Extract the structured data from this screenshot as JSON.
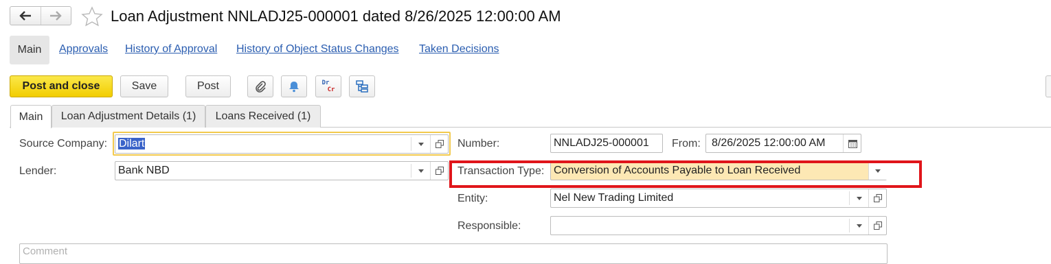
{
  "window": {
    "title": "Loan Adjustment NNLADJ25-000001 dated 8/26/2025 12:00:00 AM"
  },
  "top_nav": {
    "main": "Main",
    "links": [
      "Approvals",
      "History of Approval",
      "History of Object Status Changes",
      "Taken Decisions"
    ]
  },
  "toolbar": {
    "post_and_close": "Post and close",
    "save": "Save",
    "post": "Post",
    "drcr_dr": "Dr",
    "drcr_cr": "Cr"
  },
  "tabs": [
    "Main",
    "Loan Adjustment Details (1)",
    "Loans Received (1)"
  ],
  "form": {
    "source_company": {
      "label": "Source Company:",
      "value": "Dilart"
    },
    "lender": {
      "label": "Lender:",
      "value": "Bank NBD"
    },
    "number": {
      "label": "Number:",
      "value": "NNLADJ25-000001"
    },
    "from": {
      "label": "From:",
      "value": "8/26/2025 12:00:00 AM"
    },
    "transaction_type": {
      "label": "Transaction Type:",
      "value": "Conversion of Accounts Payable to Loan Received"
    },
    "entity": {
      "label": "Entity:",
      "value": "Nel New Trading Limited"
    },
    "responsible": {
      "label": "Responsible:",
      "value": ""
    },
    "comment": {
      "placeholder": "Comment"
    }
  },
  "colors": {
    "primary_button": "#f2cd00",
    "link": "#2a5db0",
    "highlight_box": "#e0151a",
    "field_highlight": "#fde8b4"
  }
}
